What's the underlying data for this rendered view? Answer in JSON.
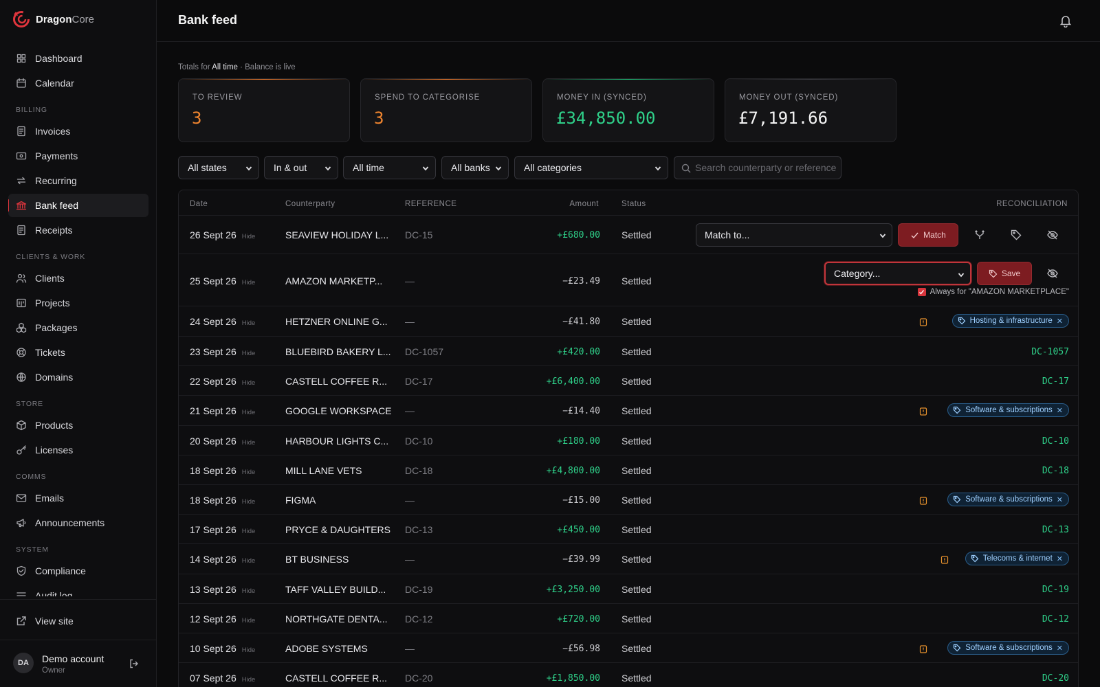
{
  "brand": {
    "name_bold": "Dragon",
    "name_light": "Core"
  },
  "sidebar": {
    "top": [
      {
        "label": "Dashboard",
        "icon": "dashboard-icon"
      },
      {
        "label": "Calendar",
        "icon": "calendar-icon"
      }
    ],
    "sections": [
      {
        "title": "BILLING",
        "items": [
          {
            "label": "Invoices",
            "icon": "invoice-icon"
          },
          {
            "label": "Payments",
            "icon": "payments-icon"
          },
          {
            "label": "Recurring",
            "icon": "recurring-icon"
          },
          {
            "label": "Bank feed",
            "icon": "bank-icon",
            "active": true
          },
          {
            "label": "Receipts",
            "icon": "receipt-icon"
          }
        ]
      },
      {
        "title": "CLIENTS & WORK",
        "items": [
          {
            "label": "Clients",
            "icon": "clients-icon"
          },
          {
            "label": "Projects",
            "icon": "projects-icon"
          },
          {
            "label": "Packages",
            "icon": "packages-icon"
          },
          {
            "label": "Tickets",
            "icon": "tickets-icon"
          },
          {
            "label": "Domains",
            "icon": "globe-icon"
          }
        ]
      },
      {
        "title": "STORE",
        "items": [
          {
            "label": "Products",
            "icon": "box-icon"
          },
          {
            "label": "Licenses",
            "icon": "key-icon"
          }
        ]
      },
      {
        "title": "COMMS",
        "items": [
          {
            "label": "Emails",
            "icon": "mail-icon"
          },
          {
            "label": "Announcements",
            "icon": "megaphone-icon"
          }
        ]
      },
      {
        "title": "SYSTEM",
        "items": [
          {
            "label": "Compliance",
            "icon": "shield-icon"
          },
          {
            "label": "Audit log",
            "icon": "list-icon"
          }
        ]
      }
    ],
    "view_site": "View site",
    "account": {
      "initials": "DA",
      "name": "Demo account",
      "role": "Owner"
    }
  },
  "header": {
    "title": "Bank feed"
  },
  "totals_note": {
    "prefix": "Totals for ",
    "range": "All time",
    "suffix": " · Balance is live"
  },
  "stats": [
    {
      "label": "TO REVIEW",
      "value": "3",
      "tone": "orange"
    },
    {
      "label": "SPEND TO CATEGORISE",
      "value": "3",
      "tone": "orange"
    },
    {
      "label": "MONEY IN (SYNCED)",
      "value": "£34,850.00",
      "tone": "green"
    },
    {
      "label": "MONEY OUT (SYNCED)",
      "value": "£7,191.66",
      "tone": "white"
    }
  ],
  "filters": {
    "state": "All states",
    "direction": "In & out",
    "period": "All time",
    "bank": "All banks",
    "category": "All categories",
    "search_placeholder": "Search counterparty or reference"
  },
  "table": {
    "headers": {
      "date": "Date",
      "counterparty": "Counterparty",
      "reference": "REFERENCE",
      "amount": "Amount",
      "status": "Status",
      "reconciliation": "RECONCILIATION"
    },
    "hide_label": "Hide",
    "match_placeholder": "Match to...",
    "match_button": "Match",
    "category_placeholder": "Category...",
    "save_button": "Save",
    "always_label": "Always for \"AMAZON MARKETPLACE\"",
    "rows": [
      {
        "date": "26 Sept 26",
        "counterparty": "SEAVIEW HOLIDAY L...",
        "reference": "DC-15",
        "amount": "+£680.00",
        "dir": "in",
        "status": "Settled",
        "recon": "match"
      },
      {
        "date": "25 Sept 26",
        "counterparty": "AMAZON MARKETP...",
        "reference": "—",
        "amount": "−£23.49",
        "dir": "out",
        "status": "Settled",
        "recon": "categorise"
      },
      {
        "date": "24 Sept 26",
        "counterparty": "HETZNER ONLINE G...",
        "reference": "—",
        "amount": "−£41.80",
        "dir": "out",
        "status": "Settled",
        "recon": "tag",
        "tag": "Hosting & infrastructure"
      },
      {
        "date": "23 Sept 26",
        "counterparty": "BLUEBIRD BAKERY L...",
        "reference": "DC-1057",
        "amount": "+£420.00",
        "dir": "in",
        "status": "Settled",
        "recon": "ref",
        "recon_ref": "DC-1057"
      },
      {
        "date": "22 Sept 26",
        "counterparty": "CASTELL COFFEE R...",
        "reference": "DC-17",
        "amount": "+£6,400.00",
        "dir": "in",
        "status": "Settled",
        "recon": "ref",
        "recon_ref": "DC-17"
      },
      {
        "date": "21 Sept 26",
        "counterparty": "GOOGLE WORKSPACE",
        "reference": "—",
        "amount": "−£14.40",
        "dir": "out",
        "status": "Settled",
        "recon": "tag",
        "tag": "Software & subscriptions"
      },
      {
        "date": "20 Sept 26",
        "counterparty": "HARBOUR LIGHTS C...",
        "reference": "DC-10",
        "amount": "+£180.00",
        "dir": "in",
        "status": "Settled",
        "recon": "ref",
        "recon_ref": "DC-10"
      },
      {
        "date": "18 Sept 26",
        "counterparty": "MILL LANE VETS",
        "reference": "DC-18",
        "amount": "+£4,800.00",
        "dir": "in",
        "status": "Settled",
        "recon": "ref",
        "recon_ref": "DC-18"
      },
      {
        "date": "18 Sept 26",
        "counterparty": "FIGMA",
        "reference": "—",
        "amount": "−£15.00",
        "dir": "out",
        "status": "Settled",
        "recon": "tag",
        "tag": "Software & subscriptions"
      },
      {
        "date": "17 Sept 26",
        "counterparty": "PRYCE & DAUGHTERS",
        "reference": "DC-13",
        "amount": "+£450.00",
        "dir": "in",
        "status": "Settled",
        "recon": "ref",
        "recon_ref": "DC-13"
      },
      {
        "date": "14 Sept 26",
        "counterparty": "BT BUSINESS",
        "reference": "—",
        "amount": "−£39.99",
        "dir": "out",
        "status": "Settled",
        "recon": "tag",
        "tag": "Telecoms & internet"
      },
      {
        "date": "13 Sept 26",
        "counterparty": "TAFF VALLEY BUILD...",
        "reference": "DC-19",
        "amount": "+£3,250.00",
        "dir": "in",
        "status": "Settled",
        "recon": "ref",
        "recon_ref": "DC-19"
      },
      {
        "date": "12 Sept 26",
        "counterparty": "NORTHGATE DENTA...",
        "reference": "DC-12",
        "amount": "+£720.00",
        "dir": "in",
        "status": "Settled",
        "recon": "ref",
        "recon_ref": "DC-12"
      },
      {
        "date": "10 Sept 26",
        "counterparty": "ADOBE SYSTEMS",
        "reference": "—",
        "amount": "−£56.98",
        "dir": "out",
        "status": "Settled",
        "recon": "tag",
        "tag": "Software & subscriptions"
      },
      {
        "date": "07 Sept 26",
        "counterparty": "CASTELL COFFEE R...",
        "reference": "DC-20",
        "amount": "+£1,850.00",
        "dir": "in",
        "status": "Settled",
        "recon": "ref",
        "recon_ref": "DC-20"
      }
    ]
  }
}
